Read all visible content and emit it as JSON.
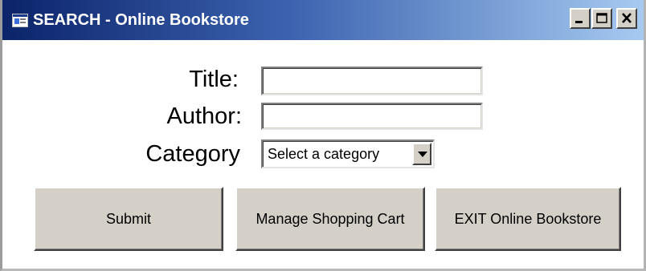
{
  "window": {
    "title": "SEARCH - Online Bookstore",
    "titlebar_gradient": [
      "#0b246a",
      "#a6caf0"
    ],
    "controls": [
      "minimize-icon",
      "maximize-icon",
      "close-icon"
    ]
  },
  "form": {
    "title_label": "Title:",
    "title_value": "",
    "author_label": "Author:",
    "author_value": "",
    "category_label": "Category",
    "category_selected": "Select a category"
  },
  "buttons": {
    "submit": "Submit",
    "cart": "Manage Shopping Cart",
    "exit": "EXIT Online Bookstore"
  }
}
